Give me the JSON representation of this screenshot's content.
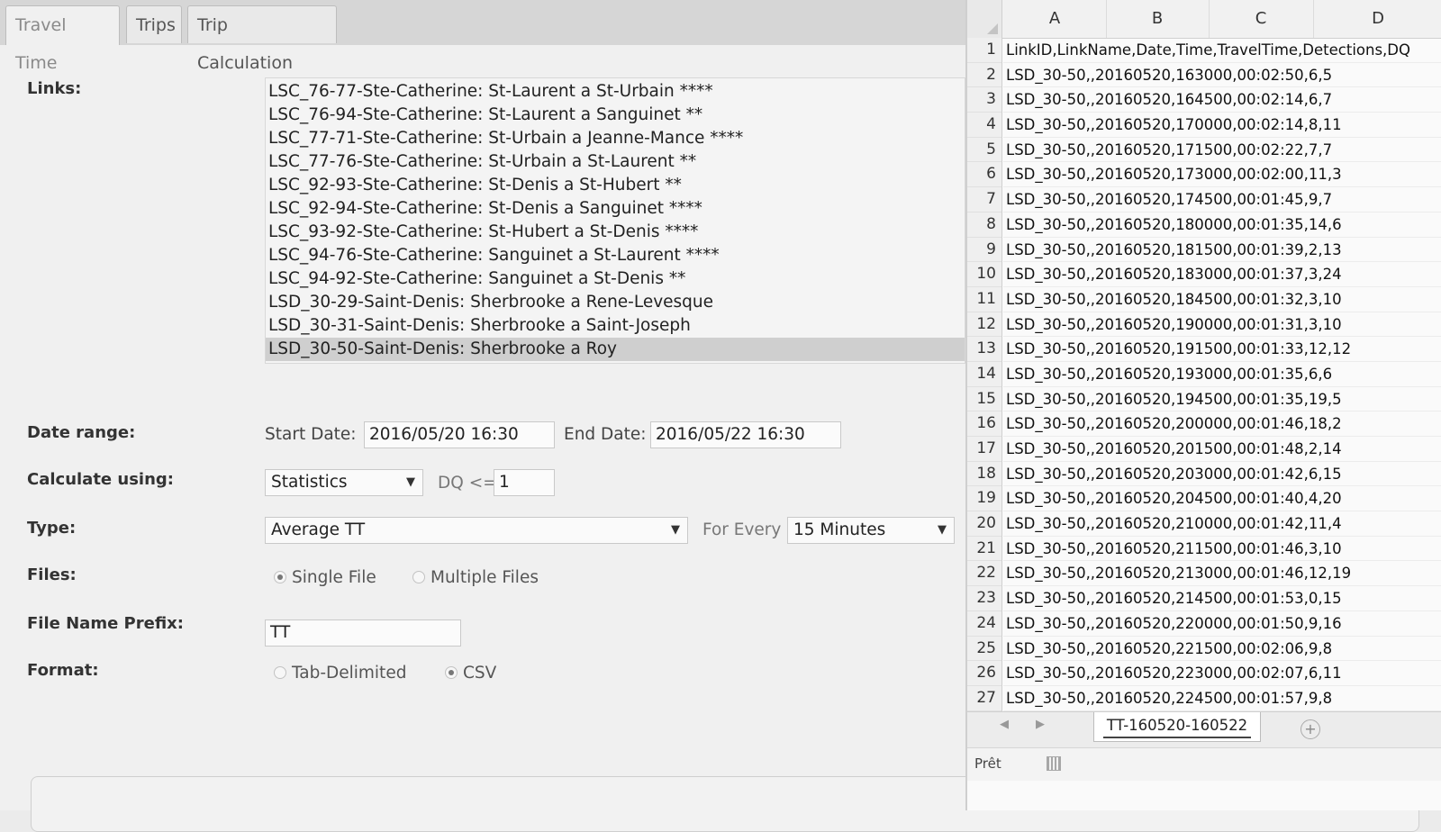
{
  "tabs": [
    {
      "label": "Travel Time",
      "active": true
    },
    {
      "label": "Trips",
      "active": false
    },
    {
      "label": "Trip Calculation",
      "active": false
    }
  ],
  "links": {
    "label": "Links:",
    "items": [
      "LSC_76-77-Ste-Catherine: St-Laurent a St-Urbain ****",
      "LSC_76-94-Ste-Catherine: St-Laurent a Sanguinet **",
      "LSC_77-71-Ste-Catherine: St-Urbain a Jeanne-Mance ****",
      "LSC_77-76-Ste-Catherine: St-Urbain a St-Laurent **",
      "LSC_92-93-Ste-Catherine: St-Denis a St-Hubert **",
      "LSC_92-94-Ste-Catherine: St-Denis a Sanguinet ****",
      "LSC_93-92-Ste-Catherine: St-Hubert a St-Denis ****",
      "LSC_94-76-Ste-Catherine: Sanguinet a St-Laurent ****",
      "LSC_94-92-Ste-Catherine: Sanguinet a St-Denis **",
      "LSD_30-29-Saint-Denis: Sherbrooke a Rene-Levesque",
      "LSD_30-31-Saint-Denis: Sherbrooke a Saint-Joseph",
      "LSD_30-50-Saint-Denis: Sherbrooke a Roy"
    ],
    "selected_index": 11
  },
  "date_range": {
    "label": "Date range:",
    "start_label": "Start Date:",
    "start_value": "2016/05/20 16:30",
    "end_label": "End Date:",
    "end_value": "2016/05/22 16:30"
  },
  "calculate": {
    "label": "Calculate using:",
    "method": "Statistics",
    "dq_label": "DQ <=",
    "dq_value": "1"
  },
  "type": {
    "label": "Type:",
    "value": "Average TT",
    "for_every_label": "For Every",
    "interval": "15 Minutes"
  },
  "files": {
    "label": "Files:",
    "options": [
      "Single File",
      "Multiple Files"
    ],
    "selected": "Single File"
  },
  "prefix": {
    "label": "File Name Prefix:",
    "value": "TT"
  },
  "format": {
    "label": "Format:",
    "options": [
      "Tab-Delimited",
      "CSV"
    ],
    "selected": "CSV"
  },
  "spreadsheet": {
    "columns": [
      "A",
      "B",
      "C",
      "D"
    ],
    "rows": [
      {
        "num": "1",
        "text": "LinkID,LinkName,Date,Time,TravelTime,Detections,DQ"
      },
      {
        "num": "2",
        "text": "LSD_30-50,,20160520,163000,00:02:50,6,5"
      },
      {
        "num": "3",
        "text": "LSD_30-50,,20160520,164500,00:02:14,6,7"
      },
      {
        "num": "4",
        "text": "LSD_30-50,,20160520,170000,00:02:14,8,11"
      },
      {
        "num": "5",
        "text": "LSD_30-50,,20160520,171500,00:02:22,7,7"
      },
      {
        "num": "6",
        "text": "LSD_30-50,,20160520,173000,00:02:00,11,3"
      },
      {
        "num": "7",
        "text": "LSD_30-50,,20160520,174500,00:01:45,9,7"
      },
      {
        "num": "8",
        "text": "LSD_30-50,,20160520,180000,00:01:35,14,6"
      },
      {
        "num": "9",
        "text": "LSD_30-50,,20160520,181500,00:01:39,2,13"
      },
      {
        "num": "10",
        "text": "LSD_30-50,,20160520,183000,00:01:37,3,24"
      },
      {
        "num": "11",
        "text": "LSD_30-50,,20160520,184500,00:01:32,3,10"
      },
      {
        "num": "12",
        "text": "LSD_30-50,,20160520,190000,00:01:31,3,10"
      },
      {
        "num": "13",
        "text": "LSD_30-50,,20160520,191500,00:01:33,12,12"
      },
      {
        "num": "14",
        "text": "LSD_30-50,,20160520,193000,00:01:35,6,6"
      },
      {
        "num": "15",
        "text": "LSD_30-50,,20160520,194500,00:01:35,19,5"
      },
      {
        "num": "16",
        "text": "LSD_30-50,,20160520,200000,00:01:46,18,2"
      },
      {
        "num": "17",
        "text": "LSD_30-50,,20160520,201500,00:01:48,2,14"
      },
      {
        "num": "18",
        "text": "LSD_30-50,,20160520,203000,00:01:42,6,15"
      },
      {
        "num": "19",
        "text": "LSD_30-50,,20160520,204500,00:01:40,4,20"
      },
      {
        "num": "20",
        "text": "LSD_30-50,,20160520,210000,00:01:42,11,4"
      },
      {
        "num": "21",
        "text": "LSD_30-50,,20160520,211500,00:01:46,3,10"
      },
      {
        "num": "22",
        "text": "LSD_30-50,,20160520,213000,00:01:46,12,19"
      },
      {
        "num": "23",
        "text": "LSD_30-50,,20160520,214500,00:01:53,0,15"
      },
      {
        "num": "24",
        "text": "LSD_30-50,,20160520,220000,00:01:50,9,16"
      },
      {
        "num": "25",
        "text": "LSD_30-50,,20160520,221500,00:02:06,9,8"
      },
      {
        "num": "26",
        "text": "LSD_30-50,,20160520,223000,00:02:07,6,11"
      },
      {
        "num": "27",
        "text": "LSD_30-50,,20160520,224500,00:01:57,9,8"
      }
    ],
    "sheet_tab": "TT-160520-160522",
    "add_sheet_icon": "plus-circle-icon",
    "status": "Prêt"
  }
}
